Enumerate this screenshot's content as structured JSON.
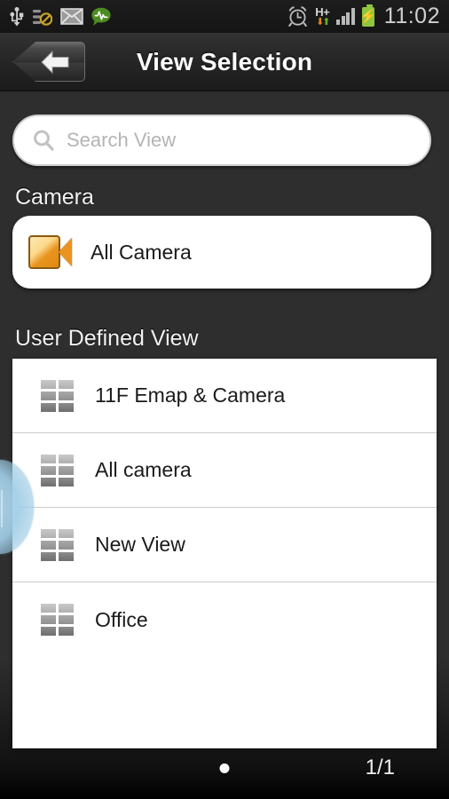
{
  "statusbar": {
    "time": "11:02",
    "network_type": "H+",
    "icons_left": [
      "usb-icon",
      "sim-disabled-icon",
      "email-icon",
      "monitor-activity-icon"
    ],
    "icons_right": [
      "alarm-clock-icon",
      "hsdpa-data-icon",
      "signal-bars-icon",
      "battery-charging-icon"
    ]
  },
  "titlebar": {
    "title": "View Selection",
    "back_icon": "back-arrow-icon"
  },
  "search": {
    "placeholder": "Search View",
    "value": "",
    "icon": "search-icon"
  },
  "camera_section": {
    "header": "Camera",
    "items": [
      {
        "label": "All Camera",
        "icon": "camcorder-icon"
      }
    ]
  },
  "user_defined_section": {
    "header": "User Defined View",
    "items": [
      {
        "label": "11F Emap & Camera",
        "icon": "grid-layout-icon"
      },
      {
        "label": "All camera",
        "icon": "grid-layout-icon"
      },
      {
        "label": "New View",
        "icon": "grid-layout-icon"
      },
      {
        "label": "Office",
        "icon": "grid-layout-icon"
      }
    ]
  },
  "footer": {
    "page_indicator": "1/1",
    "dot_icon": "page-dot-icon"
  },
  "colors": {
    "accent_orange": "#e8941f",
    "battery_green": "#8ec63f",
    "panel_white": "#ffffff",
    "background_dark": "#2e2e2e",
    "glow_blue": "#a0cde6"
  }
}
